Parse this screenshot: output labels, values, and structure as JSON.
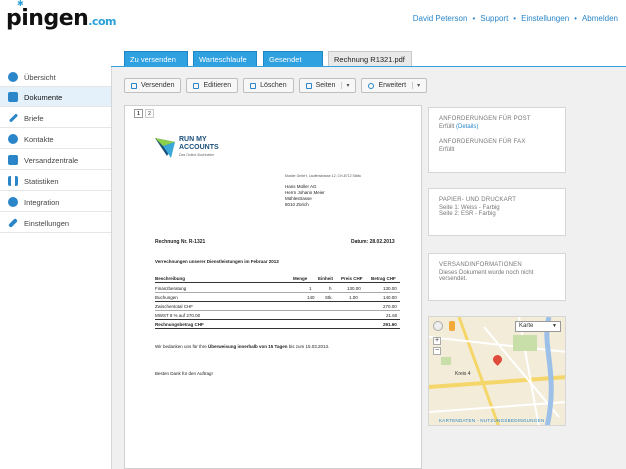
{
  "header": {
    "logo": "pingen",
    "logo_suffix": ".com",
    "user": "David Peterson",
    "links": [
      "Support",
      "Einstellungen",
      "Abmelden"
    ],
    "separator": "•"
  },
  "tabs": [
    {
      "label": "Zu versenden"
    },
    {
      "label": "Warteschlaufe"
    },
    {
      "label": "Gesendet"
    },
    {
      "label": "Rechnung R1321.pdf",
      "close": "×"
    }
  ],
  "sidebar": {
    "items": [
      {
        "label": "Übersicht",
        "icon": "globe-icon"
      },
      {
        "label": "Dokumente",
        "icon": "document-icon"
      },
      {
        "label": "Briefe",
        "icon": "pen-icon"
      },
      {
        "label": "Kontakte",
        "icon": "contacts-icon"
      },
      {
        "label": "Versandzentrale",
        "icon": "truck-icon"
      },
      {
        "label": "Statistiken",
        "icon": "bar-chart-icon"
      },
      {
        "label": "Integration",
        "icon": "gear-icon"
      },
      {
        "label": "Einstellungen",
        "icon": "wrench-icon"
      }
    ]
  },
  "toolbar": {
    "buttons": [
      {
        "label": "Versenden",
        "icon": "send-icon"
      },
      {
        "label": "Editieren",
        "icon": "edit-icon"
      },
      {
        "label": "Löschen",
        "icon": "trash-icon"
      },
      {
        "label": "Seiten",
        "icon": "pages-icon",
        "dropdown": "▾"
      },
      {
        "label": "Erweitert",
        "icon": "gear-icon",
        "dropdown": "▾"
      }
    ]
  },
  "pagination": [
    "1",
    "2"
  ],
  "document": {
    "logo_line1": "RUN MY",
    "logo_line2": "ACCOUNTS",
    "logo_tagline": "Das Online-Buchhalter",
    "sender_line": "Muster GmbH, Laufenstrasse 12, CH-8712 Stäfa",
    "recipient": [
      "Hans Müller AG",
      "Herrn Johann Meier",
      "Mühlestrasse",
      "8010 Zürich"
    ],
    "invoice_no": "Rechnung Nr. R-1321",
    "date_label": "Datum: 28.02.2013",
    "subject": "Verrechnungen unserer Dienstleistungen im Februar 2013",
    "table_headers": [
      "Beschreibung",
      "Menge",
      "Einheit",
      "Preis CHF",
      "Betrag CHF"
    ],
    "rows": [
      [
        "Finanzberatung",
        "1",
        "h",
        "130.00",
        "130.00"
      ],
      [
        "Buchungen",
        "140",
        "Stk.",
        "1.00",
        "140.00"
      ]
    ],
    "subtotal": [
      "Zwischentotal CHF",
      "270.00"
    ],
    "vat": [
      "MWST 8 % auf 270.00",
      "21.60"
    ],
    "total": [
      "Rechnungsbetrag CHF",
      "291.60"
    ],
    "payment_note_pre": "Wir bedanken uns für Ihre",
    "payment_note_bold": "Überweisung innerhalb von 15 Tagen",
    "payment_note_post": "bis zum 15.03.2013.",
    "thanks": "Besten Dank für den Auftrag!"
  },
  "panels": {
    "requirements": {
      "title_post": "ANFORDERUNGEN FÜR POST",
      "post_status": "Erfüllt",
      "details": "(Details)",
      "title_fax": "ANFORDERUNGEN FÜR FAX",
      "fax_status": "Erfüllt"
    },
    "paper": {
      "title": "PAPIER- UND DRUCKART",
      "line1": "Seite 1: Weiss - Farbig",
      "line2": "Seite 2: ESR - Farbig"
    },
    "shipping": {
      "title": "VERSANDINFORMATIONEN",
      "text": "Dieses Dokument wurde noch nicht versendet."
    }
  },
  "map": {
    "type_label": "Karte",
    "area_label": "Kreis 4",
    "links": "KARTENDATEN - NUTZUNGSBEDINGUNGEN"
  },
  "colors": {
    "accent": "#2fa0e0",
    "link": "#2a86c8"
  }
}
